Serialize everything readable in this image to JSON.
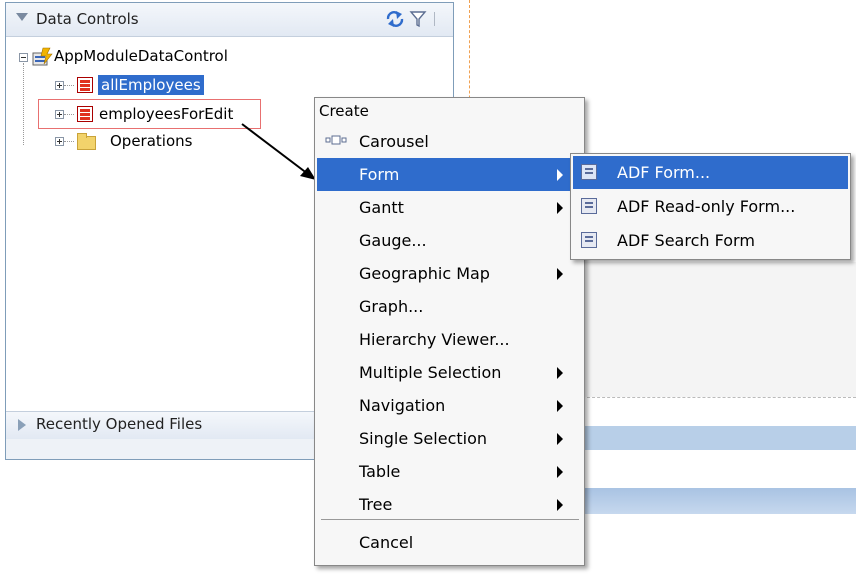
{
  "panel": {
    "title": "Data Controls",
    "recent_title": "Recently Opened Files",
    "tree": {
      "root": "AppModuleDataControl",
      "children": [
        "allEmployees",
        "employeesForEdit",
        "Operations"
      ]
    }
  },
  "menu": {
    "header": "Create",
    "items": [
      {
        "label": "Carousel",
        "submenu": false
      },
      {
        "label": "Form",
        "submenu": true,
        "active": true
      },
      {
        "label": "Gantt",
        "submenu": true
      },
      {
        "label": "Gauge...",
        "submenu": false
      },
      {
        "label": "Geographic Map",
        "submenu": true
      },
      {
        "label": "Graph...",
        "submenu": false
      },
      {
        "label": "Hierarchy Viewer...",
        "submenu": false
      },
      {
        "label": "Multiple Selection",
        "submenu": true
      },
      {
        "label": "Navigation",
        "submenu": true
      },
      {
        "label": "Single Selection",
        "submenu": true
      },
      {
        "label": "Table",
        "submenu": true
      },
      {
        "label": "Tree",
        "submenu": true
      }
    ],
    "cancel": "Cancel"
  },
  "submenu": {
    "items": [
      "ADF Form...",
      "ADF Read-only Form...",
      "ADF Search Form"
    ]
  },
  "colors": {
    "highlight": "#2f6ccc",
    "annotation_border": "#e87070"
  }
}
